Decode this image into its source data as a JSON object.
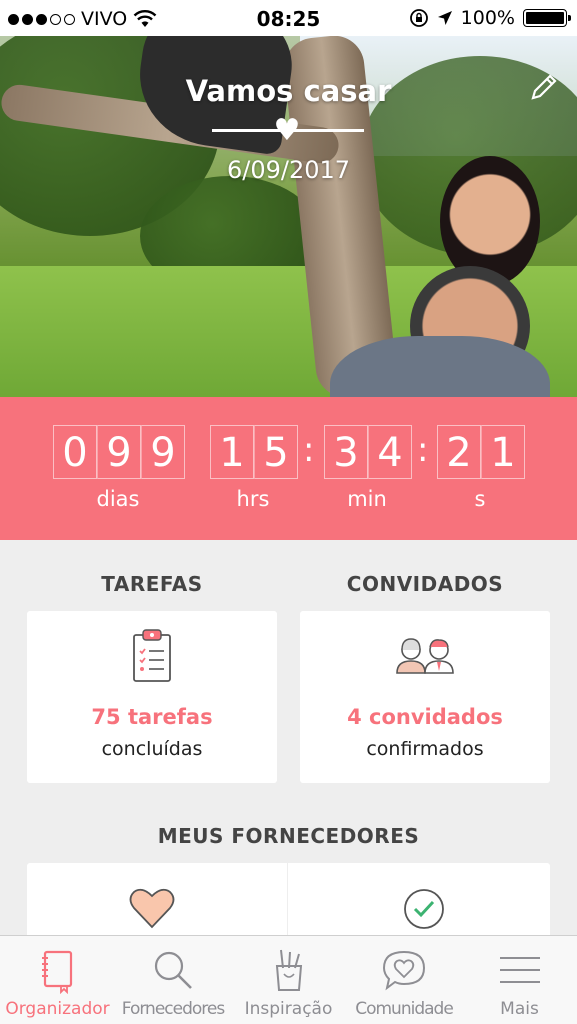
{
  "status_bar": {
    "carrier": "VIVO",
    "time": "08:25",
    "battery": "100%",
    "signal_dots_filled": 3,
    "signal_dots_total": 5
  },
  "hero": {
    "title": "Vamos casar",
    "date": "6/09/2017",
    "edit_icon": "pencil-icon",
    "heart_icon": "heart-icon"
  },
  "countdown": {
    "days": [
      "0",
      "9",
      "9"
    ],
    "hours": [
      "1",
      "5"
    ],
    "minutes": [
      "3",
      "4"
    ],
    "seconds": [
      "2",
      "1"
    ],
    "labels": {
      "days": "dias",
      "hours": "hrs",
      "minutes": "min",
      "seconds": "s"
    },
    "separator": ":",
    "accent_color": "#f7727c"
  },
  "tarefas": {
    "heading": "TAREFAS",
    "value": "75 tarefas",
    "subtitle": "concluídas",
    "icon": "clipboard-checklist-icon"
  },
  "convidados": {
    "heading": "CONVIDADOS",
    "value": "4 convidados",
    "subtitle": "confirmados",
    "icon": "guests-couple-icon"
  },
  "fornecedores": {
    "heading": "MEUS FORNECEDORES",
    "cards": [
      {
        "icon": "heart-icon"
      },
      {
        "icon": "checkmark-circle-icon"
      }
    ]
  },
  "tab_bar": {
    "tabs": [
      {
        "label": "Organizador",
        "icon": "notebook-icon",
        "active": true
      },
      {
        "label": "Fornecedores",
        "icon": "search-icon",
        "active": false
      },
      {
        "label": "Inspiração",
        "icon": "pencil-cup-icon",
        "active": false
      },
      {
        "label": "Comunidade",
        "icon": "speech-heart-icon",
        "active": false
      },
      {
        "label": "Mais",
        "icon": "menu-icon",
        "active": false
      }
    ]
  }
}
